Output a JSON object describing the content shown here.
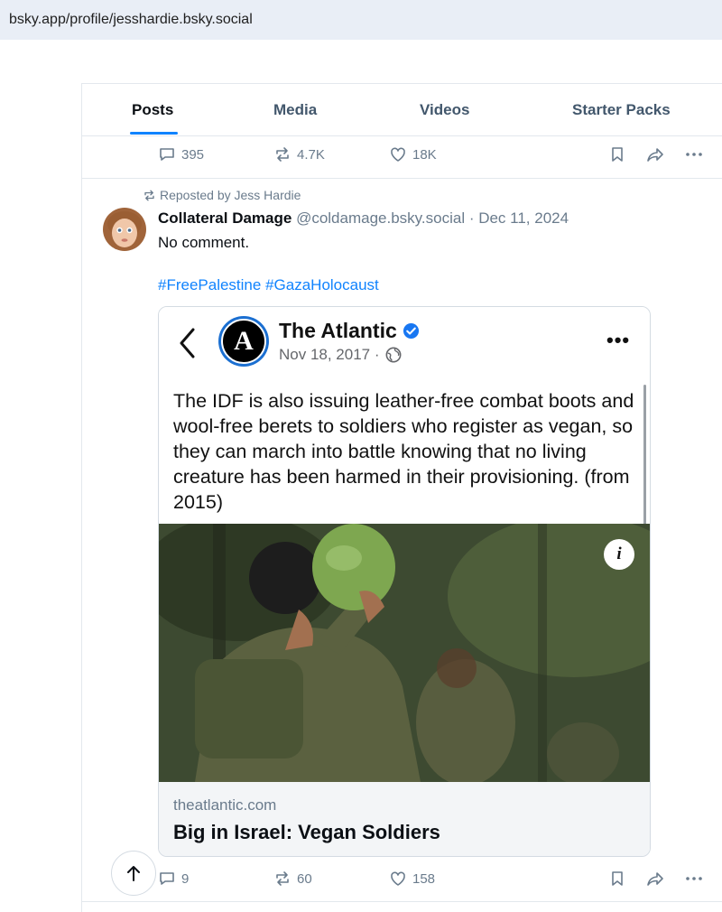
{
  "browser": {
    "url": "bsky.app/profile/jesshardie.bsky.social"
  },
  "tabs": [
    {
      "label": "Posts"
    },
    {
      "label": "Media"
    },
    {
      "label": "Videos"
    },
    {
      "label": "Starter Packs"
    }
  ],
  "prev_post": {
    "replies": "395",
    "reposts": "4.7K",
    "likes": "18K"
  },
  "post": {
    "repost_label": "Reposted by Jess Hardie",
    "author_name": "Collateral Damage",
    "author_meta": " @coldamage.bsky.social · Dec 11, 2024",
    "text": "No comment.",
    "hashtags": [
      "#FreePalestine",
      "#GazaHolocaust"
    ],
    "embed": {
      "source_name": "The Atlantic",
      "logo_letter": "A",
      "source_date": "Nov 18, 2017 ·",
      "body": "The IDF is also issuing leather-free combat boots and wool-free berets to soldiers who register as vegan, so they can march into battle knowing that no living creature has been harmed in their provisioning. (from 2015)",
      "info_glyph": "i",
      "link_domain": "theatlantic.com",
      "link_title": "Big in Israel: Vegan Soldiers"
    },
    "replies": "9",
    "reposts": "60",
    "likes": "158"
  },
  "colors": {
    "accent": "#1083fe",
    "muted": "#6a7b8c",
    "border": "#e3e8ed"
  },
  "icons": [
    "reply-icon",
    "repost-icon",
    "like-icon",
    "bookmark-icon",
    "share-icon",
    "more-icon",
    "chevron-left-icon",
    "verified-icon",
    "globe-icon",
    "info-icon",
    "arrow-up-icon"
  ]
}
